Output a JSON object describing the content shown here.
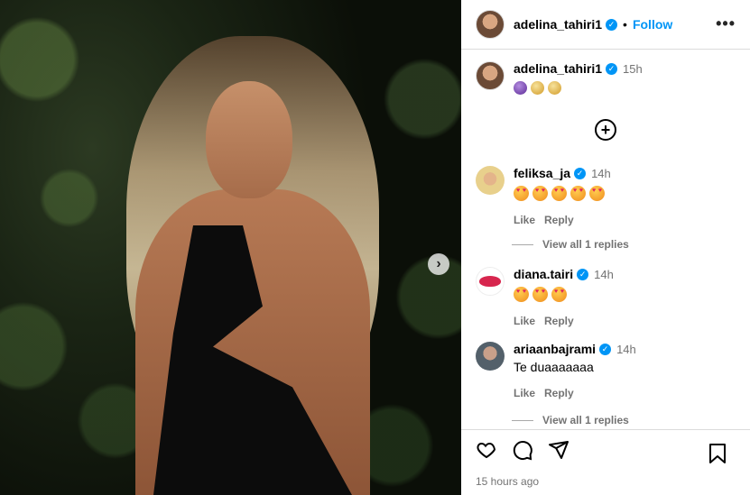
{
  "post": {
    "author": "adelina_tahiri1",
    "follow_label": "Follow",
    "dot": "•",
    "more": "•••",
    "caption_time": "15h",
    "next_arrow": "›",
    "time_ago": "15 hours ago",
    "add_symbol": "+"
  },
  "comments": [
    {
      "user": "feliksa_ja",
      "time": "14h",
      "verified": true,
      "like": "Like",
      "reply": "Reply",
      "view_replies": "View all 1 replies",
      "hearts": 5
    },
    {
      "user": "diana.tairi",
      "time": "14h",
      "verified": true,
      "like": "Like",
      "reply": "Reply",
      "hearts": 3
    },
    {
      "user": "ariaanbajrami",
      "time": "14h",
      "verified": true,
      "text": "Te duaaaaaaa",
      "like": "Like",
      "reply": "Reply",
      "view_replies": "View all 1 replies"
    }
  ],
  "icons": [
    "heart-icon",
    "comment-icon",
    "share-icon",
    "bookmark-icon",
    "verified-icon",
    "more-icon",
    "next-arrow-icon",
    "add-circle-icon"
  ],
  "colors": {
    "accent": "#0095f6",
    "muted": "#737373",
    "border": "#dbdbdb",
    "heart_emoji": "#e0245e"
  }
}
